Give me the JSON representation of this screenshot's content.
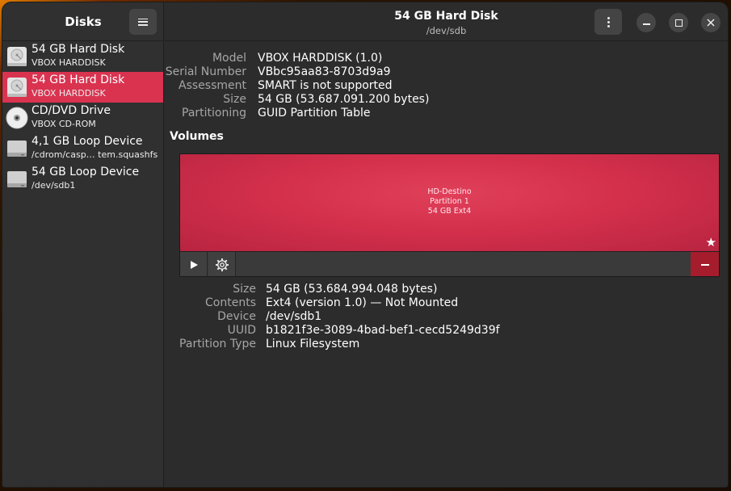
{
  "sidebar": {
    "title": "Disks",
    "items": [
      {
        "name": "54 GB Hard Disk",
        "sub": "VBOX HARDDISK",
        "icon": "hard-disk-icon",
        "selected": false
      },
      {
        "name": "54 GB Hard Disk",
        "sub": "VBOX HARDDISK",
        "icon": "hard-disk-icon",
        "selected": true
      },
      {
        "name": "CD/DVD Drive",
        "sub": "VBOX CD-ROM",
        "icon": "optical-disc-icon",
        "selected": false
      },
      {
        "name": "4,1 GB Loop Device",
        "sub": "/cdrom/casp… tem.squashfs",
        "icon": "loop-device-icon",
        "selected": false
      },
      {
        "name": "54 GB Loop Device",
        "sub": "/dev/sdb1",
        "icon": "loop-device-icon",
        "selected": false
      }
    ]
  },
  "header": {
    "title": "54 GB Hard Disk",
    "subtitle": "/dev/sdb"
  },
  "disk_info": {
    "model_label": "Model",
    "model": "VBOX HARDDISK (1.0)",
    "serial_label": "Serial Number",
    "serial": "VBbc95aa83-8703d9a9",
    "assessment_label": "Assessment",
    "assessment": "SMART is not supported",
    "size_label": "Size",
    "size": "54 GB (53.687.091.200 bytes)",
    "partitioning_label": "Partitioning",
    "partitioning": "GUID Partition Table"
  },
  "volumes": {
    "heading": "Volumes",
    "partition": {
      "name": "HD-Destino",
      "number": "Partition 1",
      "size_fs": "54 GB Ext4"
    }
  },
  "partition_info": {
    "size_label": "Size",
    "size": "54 GB (53.684.994.048 bytes)",
    "contents_label": "Contents",
    "contents": "Ext4 (version 1.0) — Not Mounted",
    "device_label": "Device",
    "device": "/dev/sdb1",
    "uuid_label": "UUID",
    "uuid": "b1821f3e-3089-4bad-bef1-cecd5249d39f",
    "type_label": "Partition Type",
    "type": "Linux Filesystem"
  },
  "colors": {
    "accent": "#d93350",
    "destructive": "#a51d2d",
    "window_bg": "#2c2c2c",
    "sidebar_bg": "#303030"
  }
}
